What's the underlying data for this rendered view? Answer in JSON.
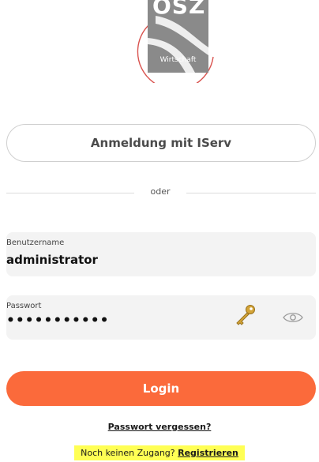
{
  "logo": {
    "lettermark": "OSZ",
    "subline": "Wirtschaft",
    "box_color": "#8a8a8a",
    "ring_color": "#d9534f"
  },
  "iserv_button": {
    "label": "Anmeldung mit IServ"
  },
  "divider": {
    "text": "oder"
  },
  "username_field": {
    "label": "Benutzername",
    "value": "administrator"
  },
  "password_field": {
    "label": "Passwort",
    "value": "•••••••••••",
    "key_icon": "key-icon",
    "toggle_icon": "eye-icon"
  },
  "login_button": {
    "label": "Login",
    "color": "#fb6a3b"
  },
  "forgot_password": {
    "label": "Passwort vergessen?"
  },
  "register": {
    "prefix": "Noch keinen Zugang?",
    "link_label": "Registrieren",
    "highlight_color": "#ffff54"
  }
}
